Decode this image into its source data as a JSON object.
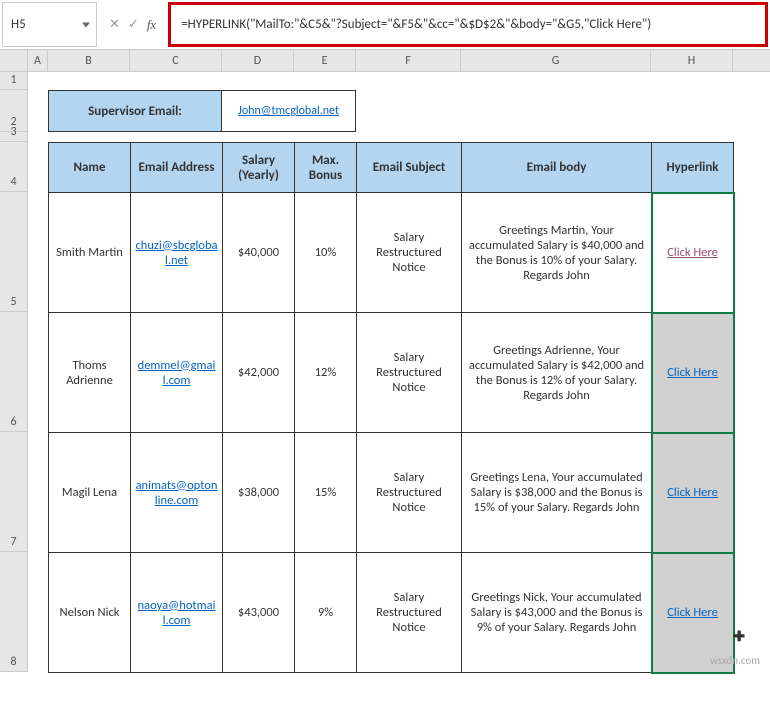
{
  "cellRef": "H5",
  "formula": "=HYPERLINK(\"MailTo:\"&C5&\"?Subject=\"&F5&\"&cc=\"&$D$2&\"&body=\"&G5,\"Click Here\")",
  "columns": [
    "A",
    "B",
    "C",
    "D",
    "E",
    "F",
    "G",
    "H"
  ],
  "rows": [
    "1",
    "2",
    "3",
    "4",
    "5",
    "6",
    "7",
    "8"
  ],
  "supervisor": {
    "label": "Supervisor Email:",
    "email": "John@tmcglobal.net"
  },
  "headers": {
    "name": "Name",
    "email": "Email Address",
    "salary": "Salary (Yearly)",
    "bonus": "Max. Bonus",
    "subject": "Email Subject",
    "body": "Email body",
    "link": "Hyperlink"
  },
  "emailSubject": "Salary Restructured Notice",
  "rowsData": [
    {
      "name": "Smith Martin",
      "email": "chuzi@sbcglobal.net",
      "salary": "$40,000",
      "bonus": "10%",
      "body": "Greetings Martin, Your accumulated Salary is $40,000 and the Bonus is 10% of your Salary. Regards John",
      "link": "Click Here"
    },
    {
      "name": "Thoms Adrienne",
      "email": "demmel@gmail.com",
      "salary": "$42,000",
      "bonus": "12%",
      "body": "Greetings Adrienne, Your accumulated Salary is $42,000 and the Bonus is 12% of your Salary. Regards John",
      "link": "Click Here"
    },
    {
      "name": "Magil Lena",
      "email": "animats@optonline.com",
      "salary": "$38,000",
      "bonus": "15%",
      "body": "Greetings Lena, Your accumulated Salary is $38,000 and the Bonus is 15% of your Salary. Regards John",
      "link": "Click Here"
    },
    {
      "name": "Nelson Nick",
      "email": "naoya@hotmail.com",
      "salary": "$43,000",
      "bonus": "9%",
      "body": "Greetings Nick, Your accumulated Salary is $43,000 and the Bonus is 9% of your Salary. Regards John",
      "link": "Click Here"
    }
  ],
  "watermark": "wsxdn.com"
}
